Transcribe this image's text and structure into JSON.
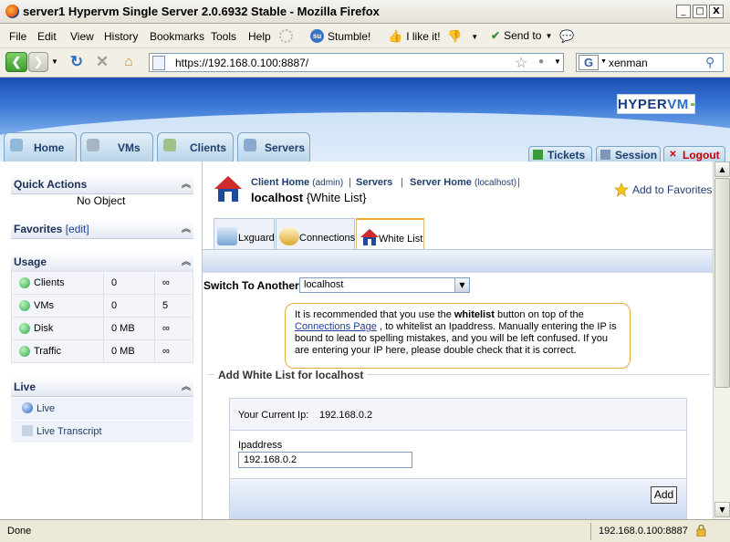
{
  "window": {
    "title": "server1 Hypervm Single Server 2.0.6932 Stable - Mozilla Firefox",
    "min": "_",
    "max": "□",
    "close": "X"
  },
  "menu": {
    "items": [
      "File",
      "Edit",
      "View",
      "History",
      "Bookmarks",
      "Tools",
      "Help"
    ],
    "stumble": "Stumble!",
    "like": "I like it!",
    "send_to": "Send to"
  },
  "nav": {
    "url": "https://192.168.0.100:8887/",
    "search_value": "xenman"
  },
  "app": {
    "logo_part1": "HYPER",
    "logo_part2": "VM",
    "tabs": [
      "Home",
      "VMs",
      "Clients",
      "Servers"
    ],
    "right_tabs": [
      "Tickets",
      "Session",
      "Logout"
    ],
    "logout_color": "#cc0000"
  },
  "sidebar": {
    "quick_actions": {
      "title": "Quick Actions",
      "value": "No Object"
    },
    "favorites": {
      "title": "Favorites",
      "edit": "[edit]"
    },
    "usage": {
      "title": "Usage",
      "rows": [
        {
          "label": "Clients",
          "used": "0",
          "limit": "∞"
        },
        {
          "label": "VMs",
          "used": "0",
          "limit": "5"
        },
        {
          "label": "Disk",
          "used": "0 MB",
          "limit": "∞"
        },
        {
          "label": "Traffic",
          "used": "0 MB",
          "limit": "∞"
        }
      ]
    },
    "live": {
      "title": "Live",
      "items": [
        "Live",
        "Live Transcript"
      ]
    }
  },
  "main": {
    "breadcrumb": {
      "client_home": "Client Home",
      "client_home_sub": "(admin)",
      "servers": "Servers",
      "server_home": "Server Home",
      "server_home_sub": "(localhost)",
      "sep": "|"
    },
    "title_host": "localhost",
    "title_suffix": " {White List}",
    "add_to_favorites": "Add to Favorites",
    "subtabs": [
      "Lxguard",
      "Connections",
      "White List"
    ],
    "switch_label": "Switch To Another",
    "switch_value": "localhost",
    "notice": {
      "p1": "It is recommended that you use the ",
      "bold": "whitelist",
      "p2": " button on top of the ",
      "link": "Connections Page",
      "p3": " , to whitelist an Ipaddress. Manually entering the IP is bound to lead to spelling mistakes, and you will be left confused. If you are entering your IP here, please double check that it is correct."
    },
    "form": {
      "legend": "Add White List for localhost",
      "current_ip_label": "Your Current Ip:",
      "current_ip_value": "192.168.0.2",
      "ipaddress_label": "Ipaddress",
      "ipaddress_value": "192.168.0.2",
      "add_button": "Add"
    }
  },
  "status": {
    "text": "Done",
    "host": "192.168.0.100:8887"
  }
}
